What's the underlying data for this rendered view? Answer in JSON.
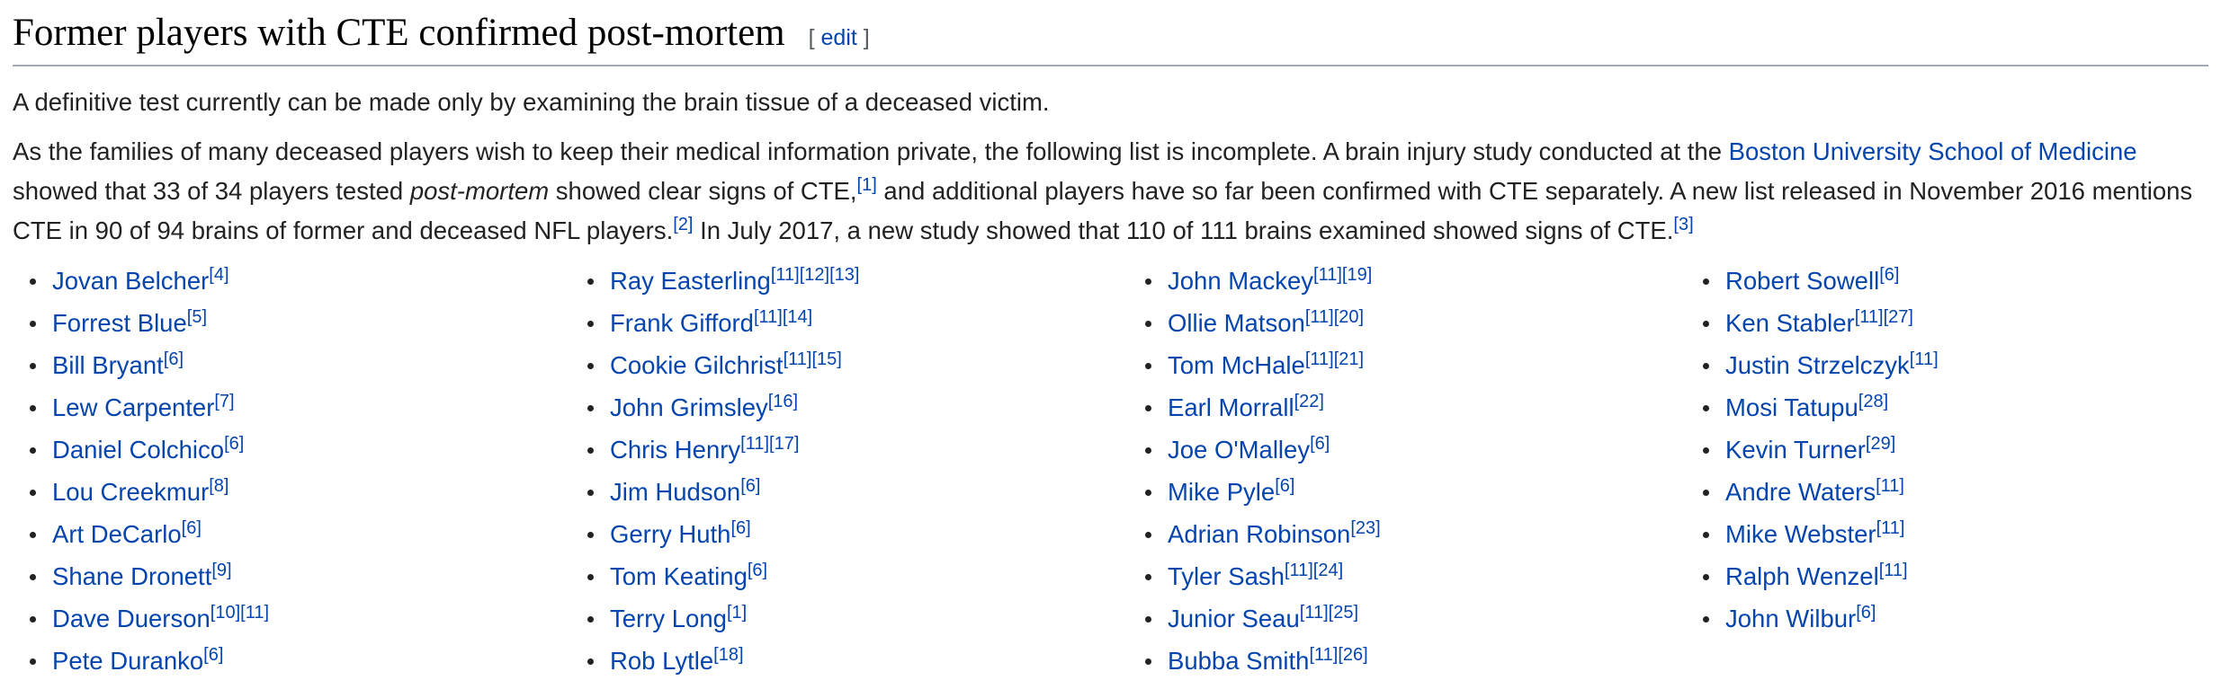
{
  "section": {
    "title": "Former players with CTE confirmed post-mortem",
    "edit_open": "[ ",
    "edit_label": "edit",
    "edit_close": " ]"
  },
  "paragraph1": "A definitive test currently can be made only by examining the brain tissue of a deceased victim.",
  "paragraph2": {
    "part1": "As the families of many deceased players wish to keep their medical information private, the following list is incomplete. A brain injury study conducted at the ",
    "link1": "Boston University School of Medicine",
    "part2": " showed that 33 of 34 players tested ",
    "emphasis": "post-mortem",
    "part3": " showed clear signs of CTE,",
    "ref1": "[1]",
    "part4": " and additional players have so far been confirmed with CTE separately. A new list released in November 2016 mentions CTE in 90 of 94 brains of former and deceased NFL players.",
    "ref2": "[2]",
    "part5": " In July 2017, a new study showed that 110 of 111 brains examined showed signs of CTE.",
    "ref3": "[3]"
  },
  "columns": [
    [
      {
        "name": "Jovan Belcher",
        "refs": [
          "[4]"
        ]
      },
      {
        "name": "Forrest Blue",
        "refs": [
          "[5]"
        ]
      },
      {
        "name": "Bill Bryant",
        "refs": [
          "[6]"
        ]
      },
      {
        "name": "Lew Carpenter",
        "refs": [
          "[7]"
        ]
      },
      {
        "name": "Daniel Colchico",
        "refs": [
          "[6]"
        ]
      },
      {
        "name": "Lou Creekmur",
        "refs": [
          "[8]"
        ]
      },
      {
        "name": "Art DeCarlo",
        "refs": [
          "[6]"
        ]
      },
      {
        "name": "Shane Dronett",
        "refs": [
          "[9]"
        ]
      },
      {
        "name": "Dave Duerson",
        "refs": [
          "[10]",
          "[11]"
        ]
      },
      {
        "name": "Pete Duranko",
        "refs": [
          "[6]"
        ]
      }
    ],
    [
      {
        "name": "Ray Easterling",
        "refs": [
          "[11]",
          "[12]",
          "[13]"
        ]
      },
      {
        "name": "Frank Gifford",
        "refs": [
          "[11]",
          "[14]"
        ]
      },
      {
        "name": "Cookie Gilchrist",
        "refs": [
          "[11]",
          "[15]"
        ]
      },
      {
        "name": "John Grimsley",
        "refs": [
          "[16]"
        ]
      },
      {
        "name": "Chris Henry",
        "refs": [
          "[11]",
          "[17]"
        ]
      },
      {
        "name": "Jim Hudson",
        "refs": [
          "[6]"
        ]
      },
      {
        "name": "Gerry Huth",
        "refs": [
          "[6]"
        ]
      },
      {
        "name": "Tom Keating",
        "refs": [
          "[6]"
        ]
      },
      {
        "name": "Terry Long",
        "refs": [
          "[1]"
        ]
      },
      {
        "name": "Rob Lytle",
        "refs": [
          "[18]"
        ]
      }
    ],
    [
      {
        "name": "John Mackey",
        "refs": [
          "[11]",
          "[19]"
        ]
      },
      {
        "name": "Ollie Matson",
        "refs": [
          "[11]",
          "[20]"
        ]
      },
      {
        "name": "Tom McHale",
        "refs": [
          "[11]",
          "[21]"
        ]
      },
      {
        "name": "Earl Morrall",
        "refs": [
          "[22]"
        ]
      },
      {
        "name": "Joe O'Malley",
        "refs": [
          "[6]"
        ]
      },
      {
        "name": "Mike Pyle",
        "refs": [
          "[6]"
        ]
      },
      {
        "name": "Adrian Robinson",
        "refs": [
          "[23]"
        ]
      },
      {
        "name": "Tyler Sash",
        "refs": [
          "[11]",
          "[24]"
        ]
      },
      {
        "name": "Junior Seau",
        "refs": [
          "[11]",
          "[25]"
        ]
      },
      {
        "name": "Bubba Smith",
        "refs": [
          "[11]",
          "[26]"
        ]
      }
    ],
    [
      {
        "name": "Robert Sowell",
        "refs": [
          "[6]"
        ]
      },
      {
        "name": "Ken Stabler",
        "refs": [
          "[11]",
          "[27]"
        ]
      },
      {
        "name": "Justin Strzelczyk",
        "refs": [
          "[11]"
        ]
      },
      {
        "name": "Mosi Tatupu",
        "refs": [
          "[28]"
        ]
      },
      {
        "name": "Kevin Turner",
        "refs": [
          "[29]"
        ]
      },
      {
        "name": "Andre Waters",
        "refs": [
          "[11]"
        ]
      },
      {
        "name": "Mike Webster",
        "refs": [
          "[11]"
        ]
      },
      {
        "name": "Ralph Wenzel",
        "refs": [
          "[11]"
        ]
      },
      {
        "name": "John Wilbur",
        "refs": [
          "[6]"
        ]
      }
    ]
  ],
  "colors": {
    "link": "#0645ad",
    "text": "#222222",
    "heading_rule": "#a2a9b1"
  }
}
